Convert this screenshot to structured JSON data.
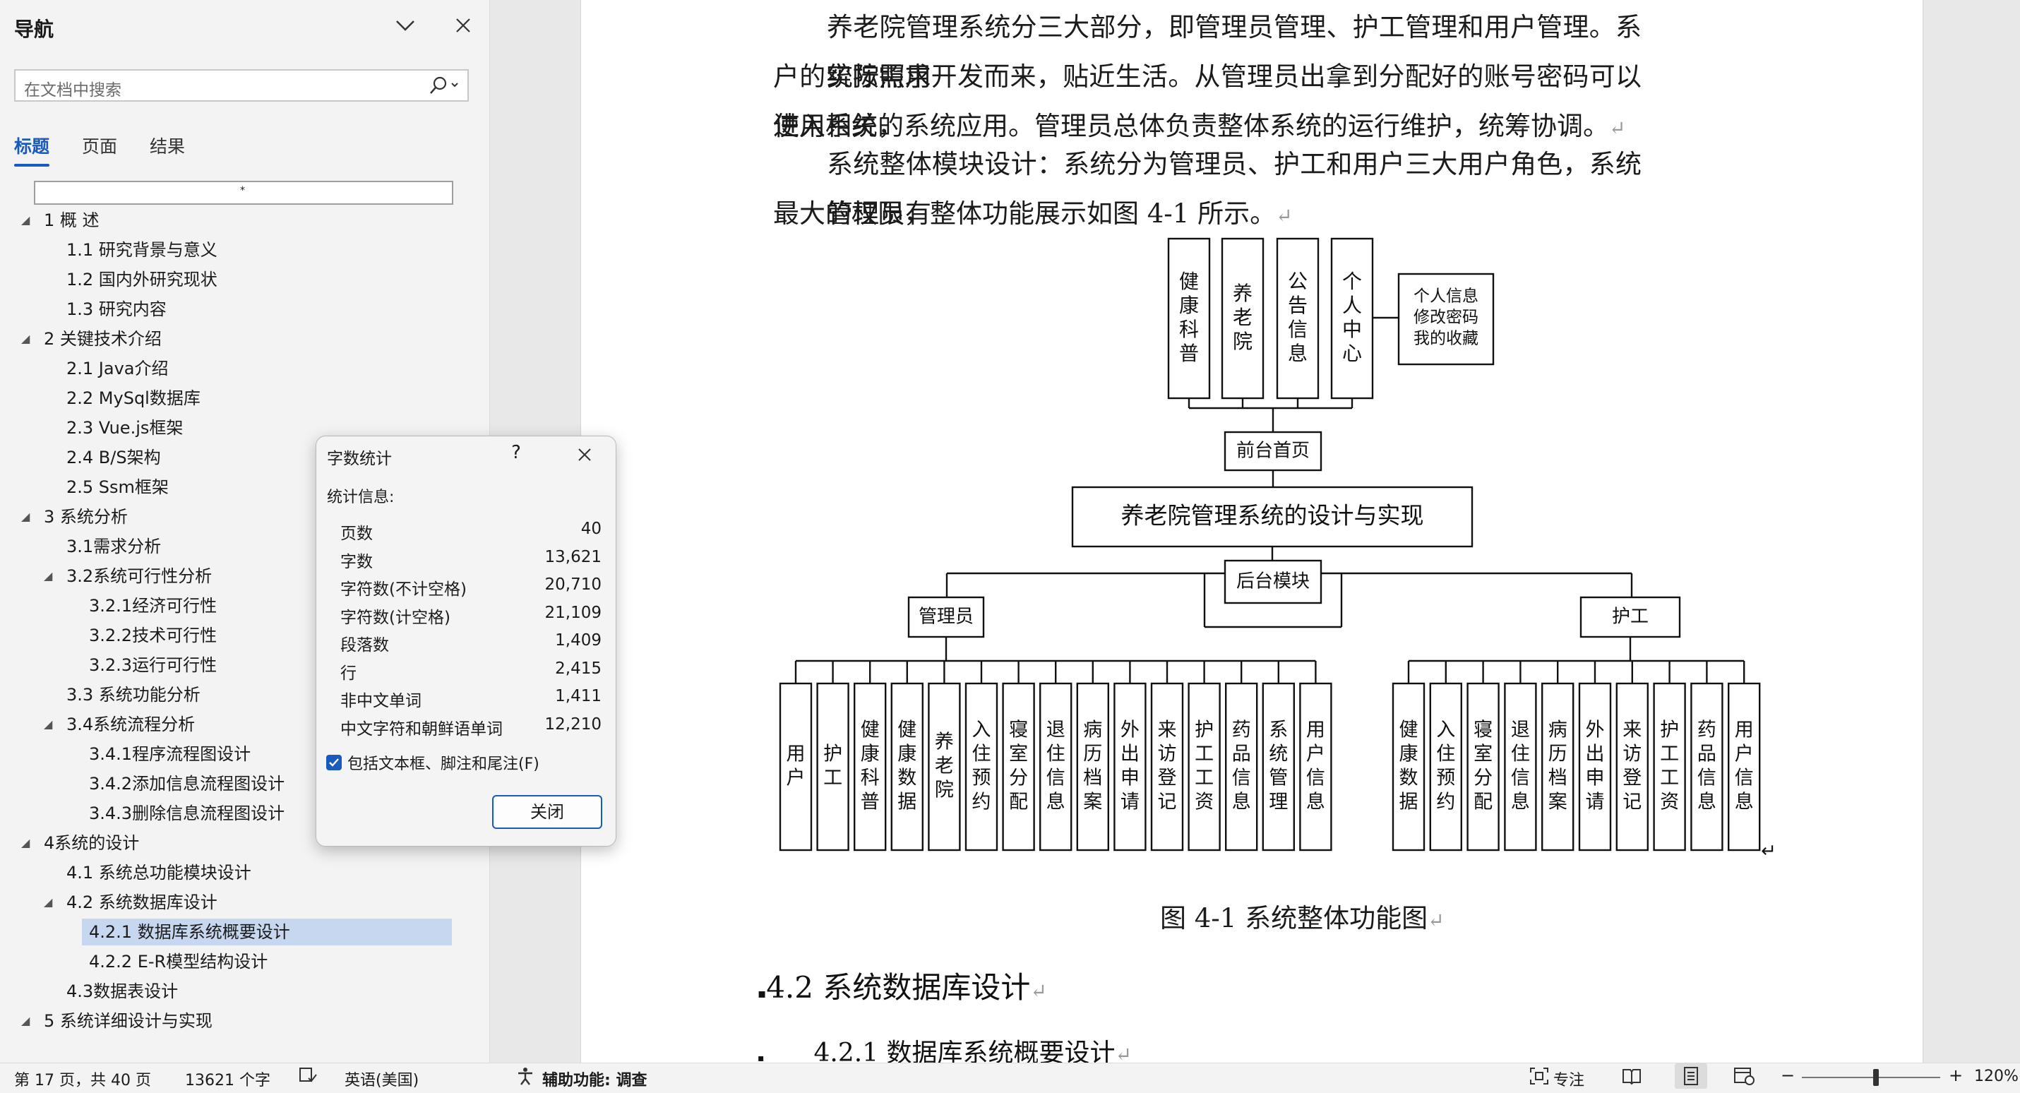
{
  "nav": {
    "title": "导航",
    "search_placeholder": "在文档中搜索",
    "tabs": [
      "标题",
      "页面",
      "结果"
    ],
    "filter_text": "*",
    "headings": [
      {
        "text": "1  概    述",
        "level": 1,
        "expanded": true
      },
      {
        "text": "1.1 研究背景与意义",
        "level": 2
      },
      {
        "text": "1.2 国内外研究现状",
        "level": 2
      },
      {
        "text": "1.3 研究内容",
        "level": 2
      },
      {
        "text": "2  关键技术介绍",
        "level": 1,
        "expanded": true
      },
      {
        "text": "2.1 Java介绍",
        "level": 2
      },
      {
        "text": "2.2 MySql数据库",
        "level": 2
      },
      {
        "text": "2.3 Vue.js框架",
        "level": 2
      },
      {
        "text": "2.4 B/S架构",
        "level": 2
      },
      {
        "text": "2.5 Ssm框架",
        "level": 2
      },
      {
        "text": "3  系统分析",
        "level": 1,
        "expanded": true
      },
      {
        "text": "3.1需求分析",
        "level": 2
      },
      {
        "text": "3.2系统可行性分析",
        "level": 2,
        "expanded": true
      },
      {
        "text": "3.2.1经济可行性",
        "level": 3
      },
      {
        "text": "3.2.2技术可行性",
        "level": 3
      },
      {
        "text": "3.2.3运行可行性",
        "level": 3
      },
      {
        "text": "3.3 系统功能分析",
        "level": 2
      },
      {
        "text": "3.4系统流程分析",
        "level": 2,
        "expanded": true
      },
      {
        "text": "3.4.1程序流程图设计",
        "level": 3
      },
      {
        "text": "3.4.2添加信息流程图设计",
        "level": 3
      },
      {
        "text": "3.4.3删除信息流程图设计",
        "level": 3
      },
      {
        "text": "4系统的设计",
        "level": 1,
        "expanded": true
      },
      {
        "text": "4.1 系统总功能模块设计",
        "level": 2
      },
      {
        "text": "4.2 系统数据库设计",
        "level": 2,
        "expanded": true
      },
      {
        "text": "4.2.1 数据库系统概要设计",
        "level": 3,
        "selected": true
      },
      {
        "text": "4.2.2 E-R模型结构设计",
        "level": 3
      },
      {
        "text": "4.3数据表设计",
        "level": 2
      },
      {
        "text": "5 系统详细设计与实现",
        "level": 1,
        "expanded": true
      }
    ]
  },
  "document": {
    "para1_lines": [
      "养老院管理系统分三大部分，即管理员管理、护工管理和用户管理。系统按照用",
      "户的实际需求开发而来，贴近生活。从管理员出拿到分配好的账号密码可以进入系统，",
      "使用相关的系统应用。管理员总体负责整体系统的运行维护，统筹协调。"
    ],
    "para2_lines": [
      "系统整体模块设计：系统分为管理员、护工和用户三大用户角色，系统管理员有",
      "最大的权限，整体功能展示如图 4-1 所示。"
    ],
    "figure_caption": "图 4-1  系统整体功能图",
    "heading_42": "4.2  系统数据库设计",
    "heading_421": "4.2.1  数据库系统概要设计",
    "diagram": {
      "front_modules": [
        "健康科普",
        "养老院",
        "公告信息",
        "个人中心"
      ],
      "personal_box": [
        "个人信息",
        "修改密码",
        "我的收藏"
      ],
      "front_home": "前台首页",
      "root": "养老院管理系统的设计与实现",
      "backend": "后台模块",
      "admin": "管理员",
      "nurse": "护工",
      "admin_modules": [
        "用户",
        "护工",
        "健康科普",
        "健康数据",
        "养老院",
        "入住预约",
        "寝室分配",
        "退住信息",
        "病历档案",
        "外出申请",
        "来访登记",
        "护工工资",
        "药品信息",
        "系统管理",
        "用户信息"
      ],
      "nurse_modules": [
        "健康数据",
        "入住预约",
        "寝室分配",
        "退住信息",
        "病历档案",
        "外出申请",
        "来访登记",
        "护工工资",
        "药品信息",
        "用户信息"
      ]
    }
  },
  "dialog": {
    "title": "字数统计",
    "help": "?",
    "section": "统计信息:",
    "stats": [
      {
        "label": "页数",
        "value": "40"
      },
      {
        "label": "字数",
        "value": "13,621"
      },
      {
        "label": "字符数(不计空格)",
        "value": "20,710"
      },
      {
        "label": "字符数(计空格)",
        "value": "21,109"
      },
      {
        "label": "段落数",
        "value": "1,409"
      },
      {
        "label": "行",
        "value": "2,415"
      },
      {
        "label": "非中文单词",
        "value": "1,411"
      },
      {
        "label": "中文字符和朝鲜语单词",
        "value": "12,210"
      }
    ],
    "checkbox_label": "包括文本框、脚注和尾注(F)",
    "checkbox_checked": true,
    "close_button": "关闭"
  },
  "status": {
    "page": "第 17 页，共 40 页",
    "words": "13621 个字",
    "language": "英语(美国)",
    "accessibility": "辅助功能: 调查",
    "focus": "专注",
    "zoom": "120%",
    "minus": "−",
    "plus": "+"
  },
  "colors": {
    "accent": "#185abd",
    "selected_bg": "#c7d7f0"
  }
}
